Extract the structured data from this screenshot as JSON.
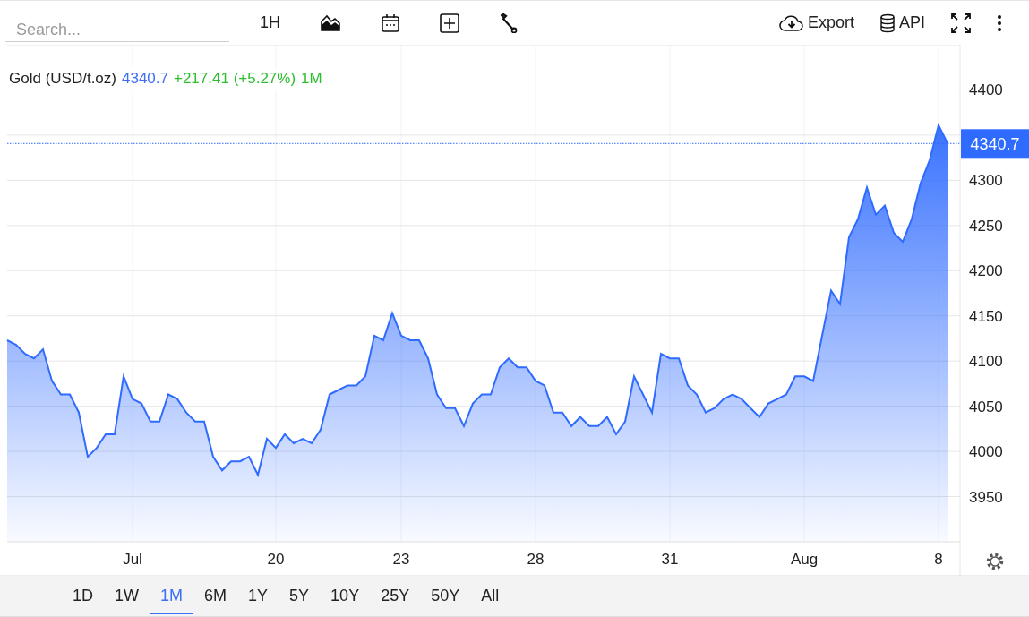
{
  "toolbar": {
    "search": {
      "placeholder": "Search..."
    },
    "interval": "1H",
    "export_label": "Export",
    "api_label": "API"
  },
  "legend": {
    "price": "4340.7",
    "change": "+217.41 (+5.27%)",
    "period": "1M"
  },
  "chart": {
    "price_badge": "4340.7",
    "chart_data": {
      "type": "area",
      "categories": [
        null,
        null,
        null,
        null,
        null,
        null,
        null,
        null,
        null,
        null,
        null,
        null,
        null,
        null,
        "Jul",
        null,
        null,
        null,
        null,
        null,
        null,
        null,
        null,
        null,
        null,
        null,
        null,
        null,
        null,
        null,
        "20",
        null,
        null,
        null,
        null,
        null,
        null,
        null,
        null,
        null,
        null,
        null,
        null,
        null,
        "23",
        null,
        null,
        null,
        null,
        null,
        null,
        null,
        null,
        null,
        null,
        null,
        null,
        null,
        null,
        "28",
        null,
        null,
        null,
        null,
        null,
        null,
        null,
        null,
        null,
        null,
        null,
        null,
        null,
        null,
        "31",
        null,
        null,
        null,
        null,
        null,
        null,
        null,
        null,
        null,
        null,
        null,
        null,
        null,
        null,
        "Aug",
        null,
        null,
        null,
        null,
        null,
        null,
        null,
        null,
        null,
        null,
        null,
        null,
        null,
        null,
        "8",
        null
      ],
      "series": [
        {
          "name": "Gold (USD/t.oz)",
          "color": "#2f6bff",
          "values": [
            4123,
            4118,
            4108,
            4103,
            4113,
            4078,
            4063,
            4063,
            4043,
            3994,
            4004,
            4019,
            4019,
            4083,
            4058,
            4053,
            4033,
            4033,
            4063,
            4058,
            4043,
            4033,
            4033,
            3994,
            3979,
            3989,
            3989,
            3994,
            3974,
            4014,
            4004,
            4019,
            4009,
            4014,
            4009,
            4024,
            4063,
            4068,
            4073,
            4073,
            4083,
            4128,
            4123,
            4153,
            4128,
            4123,
            4123,
            4103,
            4063,
            4048,
            4048,
            4028,
            4053,
            4063,
            4063,
            4093,
            4103,
            4093,
            4093,
            4078,
            4073,
            4043,
            4043,
            4028,
            4038,
            4028,
            4028,
            4038,
            4019,
            4033,
            4083,
            4063,
            4043,
            4108,
            4103,
            4103,
            4073,
            4063,
            4043,
            4048,
            4058,
            4063,
            4058,
            4048,
            4038,
            4053,
            4058,
            4063,
            4083,
            4083,
            4078,
            4128,
            4178,
            4163,
            4237,
            4257,
            4292,
            4262,
            4272,
            4242,
            4232,
            4257,
            4297,
            4322,
            4361,
            4341
          ]
        }
      ],
      "grid": true,
      "ref_lines": [
        {
          "axis": "y",
          "value": 4340.7
        }
      ],
      "ylim": [
        3900,
        4450
      ],
      "yticks": [
        3950,
        4000,
        4050,
        4100,
        4150,
        4200,
        4250,
        4300,
        4400
      ]
    }
  },
  "ranges": [
    {
      "label": "1D",
      "selected": false
    },
    {
      "label": "1W",
      "selected": false
    },
    {
      "label": "1M",
      "selected": true
    },
    {
      "label": "6M",
      "selected": false
    },
    {
      "label": "1Y",
      "selected": false
    },
    {
      "label": "5Y",
      "selected": false
    },
    {
      "label": "10Y",
      "selected": false
    },
    {
      "label": "25Y",
      "selected": false
    },
    {
      "label": "50Y",
      "selected": false
    },
    {
      "label": "All",
      "selected": false
    }
  ]
}
